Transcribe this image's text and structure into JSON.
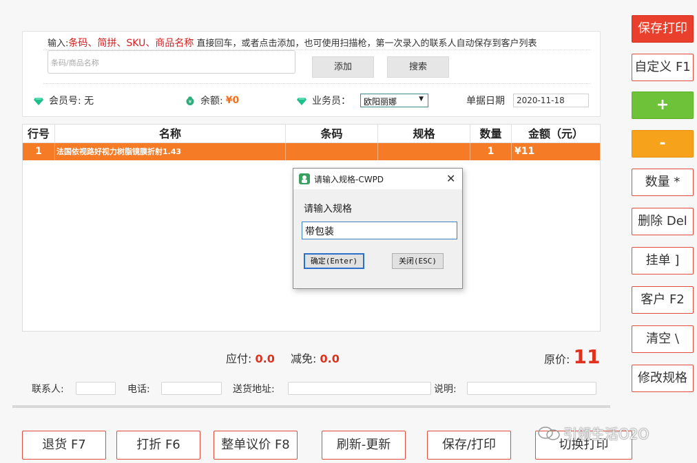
{
  "search": {
    "hint_prefix": "输入:",
    "hint_keys": "条码、简拼、SKU、商品名称",
    "hint_suffix": " 直接回车，或者点击添加，也可使用扫描枪，第一次录入的联系人自动保存到客户列表",
    "placeholder": "条码/商品名称",
    "add_label": "添加",
    "search_label": "搜索"
  },
  "info": {
    "member_label": "会员号:",
    "member_value": "无",
    "balance_label": "余额:",
    "balance_value": "¥0",
    "salesman_label": "业务员：",
    "salesman_value": "欧阳丽娜",
    "date_label": "单据日期",
    "date_value": "2020-11-18"
  },
  "table": {
    "headers": [
      "行号",
      "名称",
      "条码",
      "规格",
      "数量",
      "金额（元）"
    ],
    "rows": [
      {
        "no": "1",
        "name": "法国依视路好视力树脂镜膜折射1.43",
        "barcode": "",
        "spec": "",
        "qty": "1",
        "amount": "¥11"
      }
    ]
  },
  "dialog": {
    "title": "请输入规格-CWPD",
    "close": "✕",
    "label": "请输入规格",
    "value": "带包装",
    "ok_label": "确定(Enter)",
    "cancel_label": "关闭(ESC)"
  },
  "totals": {
    "payable_label": "应付:",
    "payable_value": "0.0",
    "discount_label": "减免:",
    "discount_value": "0.0",
    "original_label": "原价:",
    "original_value": "11"
  },
  "contact": {
    "contact_label": "联系人:",
    "phone_label": "电话:",
    "address_label": "送货地址:",
    "note_label": "说明:"
  },
  "sidebar": [
    "保存打印",
    "自定义 F1",
    "+",
    "-",
    "数量 *",
    "删除 Del",
    "挂单 ]",
    "客户 F2",
    "清空 \\",
    "修改规格"
  ],
  "bottom": [
    "退货 F7",
    "打折 F6",
    "整单议价 F8",
    "刷新-更新",
    "保存/打印",
    "切换打印"
  ],
  "watermark": "引领生活O2O",
  "colors": {
    "accent": "#f57b26",
    "red": "#e8402c",
    "green": "#6ec23a",
    "orange": "#f7a21b"
  }
}
